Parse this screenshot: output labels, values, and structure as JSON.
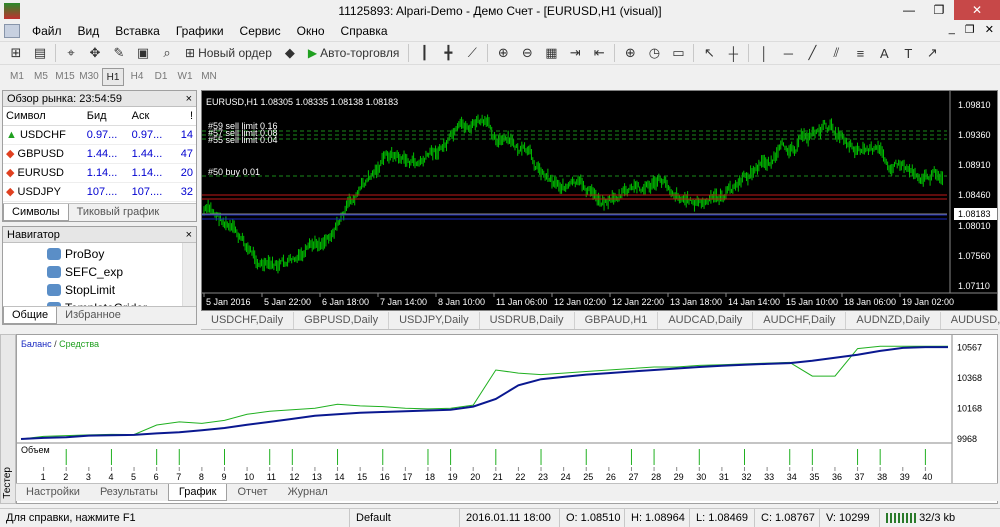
{
  "window": {
    "title": "11125893: Alpari-Demo - Демо Счет - [EURUSD,H1 (visual)]",
    "minimize": "—",
    "restore": "❐",
    "close": "✕"
  },
  "menu": {
    "items": [
      "Файл",
      "Вид",
      "Вставка",
      "Графики",
      "Сервис",
      "Окно",
      "Справка"
    ],
    "mdi": [
      "_",
      "❐",
      "✕"
    ]
  },
  "toolbar": {
    "new_order": "Новый ордер",
    "auto_trading": "Авто-торговля"
  },
  "timeframes": {
    "items": [
      "M1",
      "M5",
      "M15",
      "M30",
      "H1",
      "H4",
      "D1",
      "W1",
      "MN"
    ],
    "active": "H1"
  },
  "market_watch": {
    "title": "Обзор рынка: 23:54:59",
    "close": "×",
    "columns": [
      "Символ",
      "Бид",
      "Аск",
      "!"
    ],
    "rows": [
      {
        "symbol": "USDCHF",
        "bid": "0.97...",
        "ask": "0.97...",
        "count": "14",
        "dir": "up"
      },
      {
        "symbol": "GBPUSD",
        "bid": "1.44...",
        "ask": "1.44...",
        "count": "47",
        "dir": "down"
      },
      {
        "symbol": "EURUSD",
        "bid": "1.14...",
        "ask": "1.14...",
        "count": "20",
        "dir": "down"
      },
      {
        "symbol": "USDJPY",
        "bid": "107....",
        "ask": "107....",
        "count": "32",
        "dir": "down"
      }
    ],
    "tabs": [
      "Символы",
      "Тиковый график"
    ]
  },
  "navigator": {
    "title": "Навигатор",
    "close": "×",
    "items": [
      "ProBoy",
      "SEFC_exp",
      "StopLimit",
      "TemplateGrider"
    ],
    "tabs": [
      "Общие",
      "Избранное"
    ]
  },
  "chart": {
    "header": "EURUSD,H1  1.08305 1.08335 1.08138 1.08183",
    "order_labels": [
      "#59 sell limit 0.16",
      "#57 sell limit 0.08",
      "#55 sell limit 0.04",
      "#50 buy 0.01"
    ],
    "price_labels": [
      "1.09810",
      "1.09360",
      "1.08910",
      "1.08460",
      "1.08183",
      "1.08010",
      "1.07560",
      "1.07110"
    ],
    "current_price": "1.08183",
    "time_labels": [
      "5 Jan 2016",
      "5 Jan 22:00",
      "6 Jan 18:00",
      "7 Jan 14:00",
      "8 Jan 10:00",
      "11 Jan 06:00",
      "12 Jan 02:00",
      "12 Jan 22:00",
      "13 Jan 18:00",
      "14 Jan 14:00",
      "15 Jan 10:00",
      "18 Jan 06:00",
      "19 Jan 02:00"
    ],
    "colors": {
      "bg": "#000000",
      "candle": "#00c000",
      "grid": "#606060",
      "sell": "#c01818",
      "buy": "#1828c0"
    },
    "tabs": [
      "USDCHF,Daily",
      "GBPUSD,Daily",
      "USDJPY,Daily",
      "USDRUB,Daily",
      "GBPAUD,H1",
      "AUDCAD,Daily",
      "AUDCHF,Daily",
      "AUDNZD,Daily",
      "AUDUSD,"
    ],
    "tab_scroll": [
      "◄",
      "►"
    ]
  },
  "tester": {
    "side_label": "Тестер",
    "legend_balance": "Баланс",
    "legend_sep": " / ",
    "legend_equity": "Средства",
    "volume_label": "Объем",
    "y_labels": [
      "10567",
      "10368",
      "10168",
      "9968"
    ],
    "x_labels": [
      "1",
      "2",
      "3",
      "4",
      "5",
      "6",
      "7",
      "8",
      "9",
      "10",
      "11",
      "12",
      "13",
      "14",
      "15",
      "16",
      "17",
      "18",
      "19",
      "20",
      "21",
      "22",
      "23",
      "24",
      "25",
      "26",
      "27",
      "28",
      "29",
      "30",
      "31",
      "32",
      "33",
      "34",
      "35",
      "36",
      "37",
      "38",
      "39",
      "40"
    ],
    "tabs": [
      "Настройки",
      "Результаты",
      "График",
      "Отчет",
      "Журнал"
    ],
    "active_tab": "График"
  },
  "chart_data": {
    "type": "line",
    "x": [
      0,
      1,
      2,
      3,
      4,
      5,
      6,
      7,
      8,
      9,
      10,
      11,
      12,
      13,
      14,
      15,
      16,
      17,
      18,
      19,
      20,
      21,
      22,
      23,
      24,
      25,
      26,
      27,
      28,
      29,
      30,
      31,
      32,
      33,
      34,
      35,
      36,
      37,
      38,
      39,
      40,
      41
    ],
    "series": [
      {
        "name": "Баланс",
        "values": [
          9968,
          9975,
          9980,
          9990,
          9992,
          9995,
          10005,
          10012,
          10025,
          10040,
          10062,
          10080,
          10100,
          10120,
          10130,
          10140,
          10145,
          10150,
          10155,
          10160,
          10180,
          10230,
          10320,
          10360,
          10375,
          10390,
          10400,
          10410,
          10420,
          10430,
          10440,
          10448,
          10455,
          10460,
          10465,
          10480,
          10500,
          10520,
          10545,
          10565,
          10570,
          10570
        ]
      },
      {
        "name": "Средства",
        "values": [
          9968,
          9985,
          9990,
          9995,
          9998,
          9997,
          10060,
          10080,
          10070,
          10090,
          10130,
          10150,
          10160,
          10170,
          10195,
          10185,
          10180,
          10170,
          10165,
          10170,
          10190,
          10420,
          10400,
          10390,
          10400,
          10410,
          10420,
          10430,
          10440,
          10440,
          10450,
          10455,
          10460,
          10465,
          10470,
          10380,
          10380,
          10560,
          10575,
          10575,
          10575,
          10575
        ]
      }
    ],
    "volume": [
      0,
      0,
      1,
      0,
      1,
      0,
      1,
      1,
      0,
      1,
      0,
      1,
      1,
      0,
      1,
      0,
      1,
      0,
      1,
      1,
      0,
      1,
      0,
      1,
      0,
      1,
      0,
      1,
      1,
      0,
      1,
      0,
      1,
      0,
      1,
      1,
      0,
      1,
      1,
      0,
      1,
      0
    ],
    "ylim": [
      9968,
      10610
    ],
    "xlabel": "",
    "ylabel": ""
  },
  "status": {
    "help": "Для справки, нажмите F1",
    "profile": "Default",
    "datetime": "2016.01.11 18:00",
    "open": "O: 1.08510",
    "high": "H: 1.08964",
    "low": "L: 1.08469",
    "close": "C: 1.08767",
    "volume": "V: 10299",
    "traffic": "32/3 kb"
  }
}
